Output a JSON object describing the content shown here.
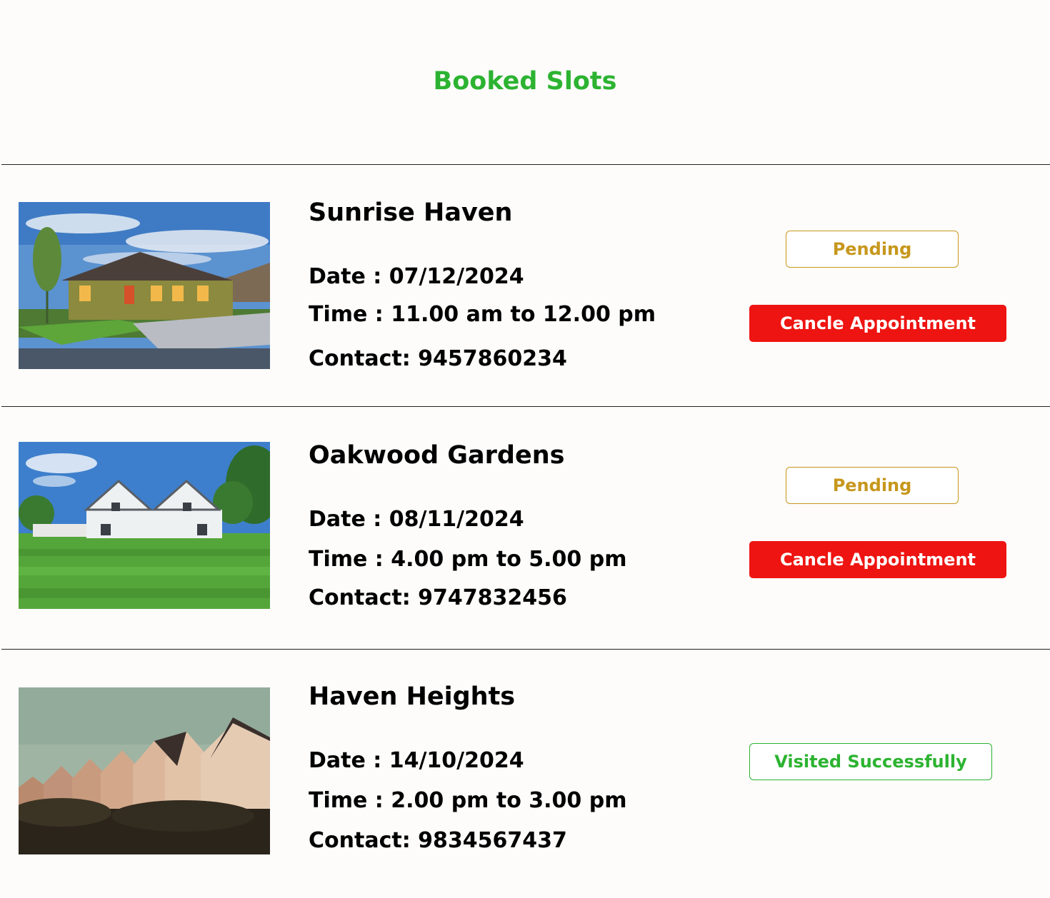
{
  "page": {
    "title": "Booked Slots"
  },
  "slots": [
    {
      "name": "Sunrise Haven",
      "date": "Date : 07/12/2024",
      "time": "Time : 11.00 am to 12.00 pm",
      "contact": "Contact: 9457860234",
      "status": "Pending",
      "cancel_label": "Cancle Appointment",
      "image": "suburban-house-photo"
    },
    {
      "name": "Oakwood Gardens",
      "date": "Date : 08/11/2024",
      "time": "Time : 4.00 pm to 5.00 pm",
      "contact": "Contact: 9747832456",
      "status": "Pending",
      "cancel_label": "Cancle Appointment",
      "image": "white-house-lawn-photo"
    },
    {
      "name": "Haven Heights",
      "date": "Date : 14/10/2024",
      "time": "Time : 2.00 pm to 3.00 pm",
      "contact": "Contact: 9834567437",
      "status": "Visited Successfully",
      "image": "row-houses-photo"
    }
  ],
  "colors": {
    "title": "#2cb331",
    "pending": "#c7971d",
    "visited": "#2cb331",
    "cancel": "#ee1411"
  }
}
